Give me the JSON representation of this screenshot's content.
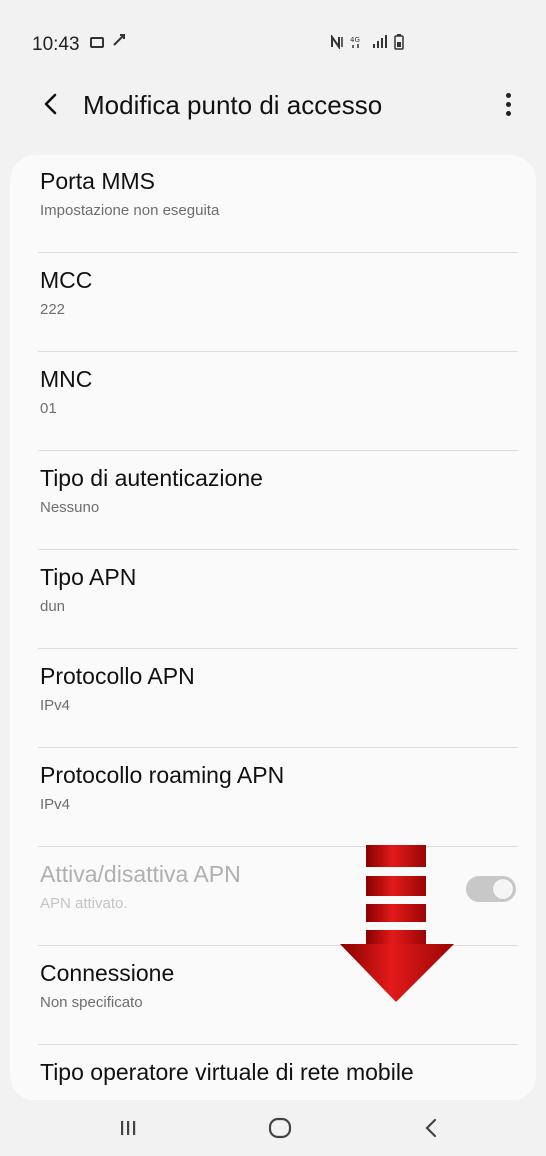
{
  "status_bar": {
    "time": "10:43",
    "left_icons": [
      "image-icon",
      "wifi-call-icon"
    ],
    "right_icons": [
      "nfc-icon",
      "4g-icon",
      "signal-icon",
      "battery-icon"
    ]
  },
  "header": {
    "title": "Modifica punto di accesso",
    "back_icon": "chevron-left-icon",
    "more_icon": "more-vertical-icon"
  },
  "items": [
    {
      "title": "Porta MMS",
      "value": "Impostazione non eseguita"
    },
    {
      "title": "MCC",
      "value": "222"
    },
    {
      "title": "MNC",
      "value": "01"
    },
    {
      "title": "Tipo di autenticazione",
      "value": "Nessuno"
    },
    {
      "title": "Tipo APN",
      "value": "dun"
    },
    {
      "title": "Protocollo APN",
      "value": "IPv4"
    },
    {
      "title": "Protocollo roaming APN",
      "value": "IPv4"
    },
    {
      "title": "Attiva/disattiva APN",
      "value": "APN attivato.",
      "enabled": false,
      "toggle_on": true
    },
    {
      "title": "Connessione",
      "value": "Non specificato"
    },
    {
      "title": "Tipo operatore virtuale di rete mobile",
      "value": ""
    }
  ],
  "overlay": {
    "arrow_icon": "red-down-arrow-icon",
    "arrow_color": "#cc1111"
  },
  "nav_bar": {
    "buttons": [
      "recent-apps-icon",
      "home-icon",
      "back-icon"
    ]
  },
  "colors": {
    "background": "#f2f2f2",
    "card": "#fafafa",
    "divider": "#dcdcdc",
    "secondary_text": "#6e6e6e"
  }
}
